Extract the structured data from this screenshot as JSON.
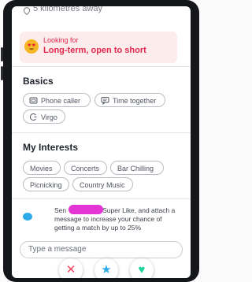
{
  "distance": {
    "text": "5 kilometres away"
  },
  "looking_for": {
    "label": "Looking for",
    "value": "Long-term, open to short"
  },
  "basics": {
    "title": "Basics",
    "items": [
      {
        "label": "Phone caller",
        "icon": "phone-caller-icon"
      },
      {
        "label": "Time together",
        "icon": "chat-bubble-icon"
      },
      {
        "label": "Virgo",
        "icon": "zodiac-icon"
      }
    ]
  },
  "interests": {
    "title": "My Interests",
    "items": [
      "Movies",
      "Concerts",
      "Bar Chilling",
      "Picnicking",
      "Country Music"
    ]
  },
  "promo": {
    "prefix": "Sen",
    "text": "Super Like, and attach a message to increase your chance of getting a match by up to 25%"
  },
  "message": {
    "placeholder": "Type a message"
  },
  "colors": {
    "accent_red": "#e0284c",
    "pill_bg": "#fdecec",
    "super_like_blue": "#2cabe8",
    "like_green": "#1fd39a",
    "nope_red": "#f0455f"
  },
  "actions": [
    {
      "name": "nope",
      "icon": "x-icon"
    },
    {
      "name": "super-like",
      "icon": "star-icon"
    },
    {
      "name": "like",
      "icon": "heart-icon"
    }
  ]
}
